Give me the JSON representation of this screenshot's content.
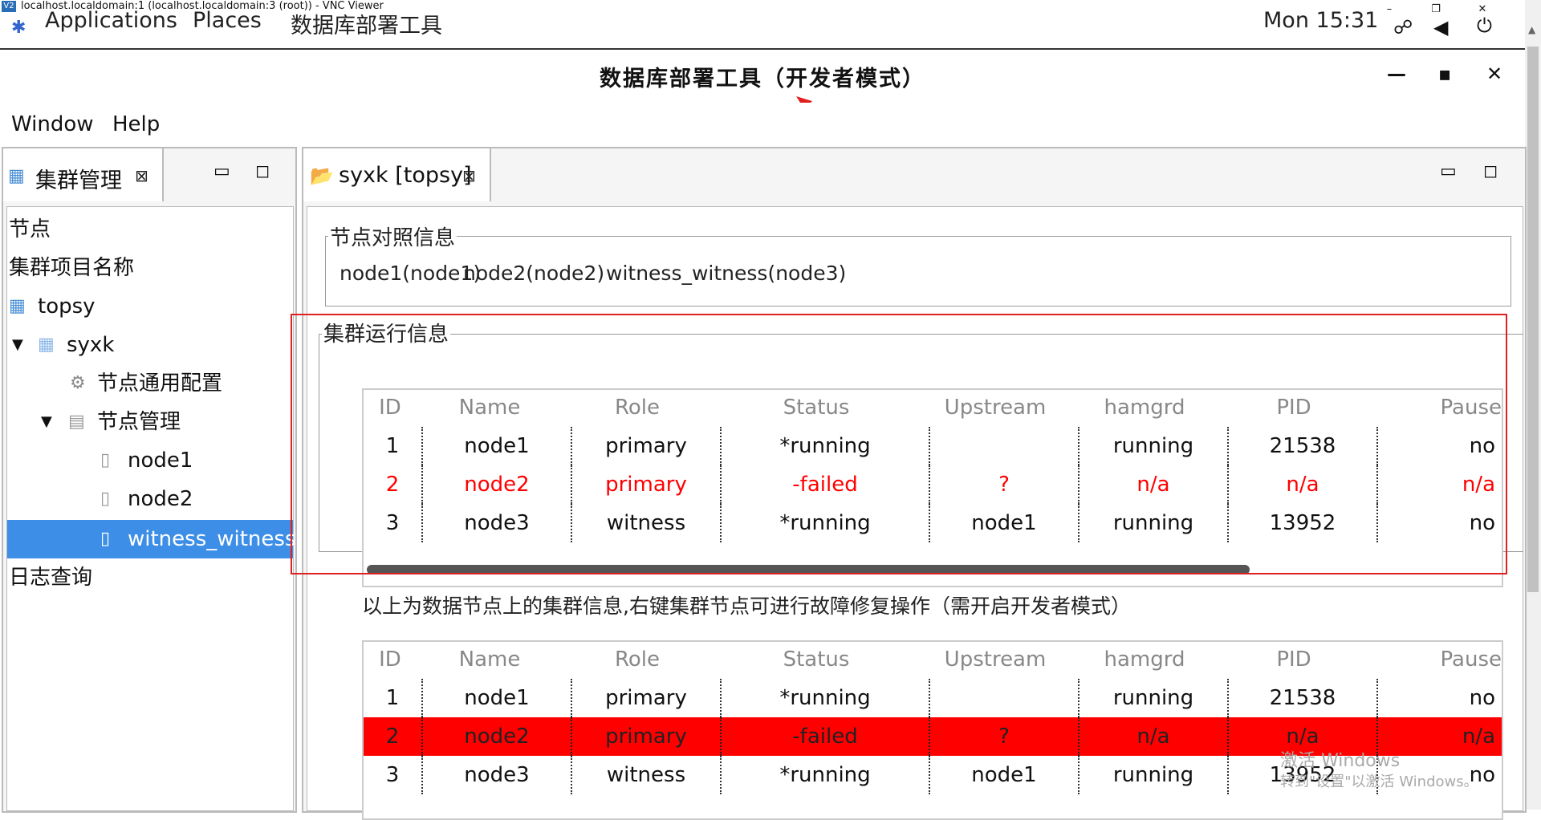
{
  "vnc": {
    "title": "localhost.localdomain:1 (localhost.localdomain:3 (root)) - VNC Viewer",
    "logo": "V2"
  },
  "topbar": {
    "applications": "Applications",
    "places": "Places",
    "app_name": "数据库部署工具",
    "clock": "Mon 15:31"
  },
  "window": {
    "title": "数据库部署工具（开发者模式）",
    "minimize": "—",
    "maximize": "▪",
    "close": "✕"
  },
  "menu": {
    "window": "Window",
    "help": "Help"
  },
  "left_view": {
    "tab_label": "集群管理",
    "tree": [
      {
        "label": "节点"
      },
      {
        "label": "集群项目名称"
      },
      {
        "label": "topsy"
      },
      {
        "label": "syxk"
      },
      {
        "label": "节点通用配置"
      },
      {
        "label": "节点管理"
      },
      {
        "label": "node1"
      },
      {
        "label": "node2"
      },
      {
        "label": "witness_witness"
      },
      {
        "label": "日志查询"
      }
    ]
  },
  "editor": {
    "tab_label": "syxk [topsy]",
    "node_map": {
      "title": "节点对照信息",
      "entries": [
        "node1(node1)",
        "node2(node2)",
        "witness_witness(node3)"
      ]
    },
    "cluster_info": {
      "title": "集群运行信息",
      "columns": [
        "ID",
        "Name",
        "Role",
        "Status",
        "Upstream",
        "hamgrd",
        "PID",
        "Pause"
      ],
      "rows": [
        [
          "1",
          "node1",
          "primary",
          "*running",
          "",
          "running",
          "21538",
          "no"
        ],
        [
          "2",
          "node2",
          "primary",
          "-failed",
          "?",
          "n/a",
          "n/a",
          "n/a"
        ],
        [
          "3",
          "node3",
          "witness",
          "*running",
          "node1",
          "running",
          "13952",
          "no"
        ]
      ]
    },
    "note": "以上为数据节点上的集群信息,右键集群节点可进行故障修复操作（需开启开发者模式）",
    "cluster_info_2": {
      "columns": [
        "ID",
        "Name",
        "Role",
        "Status",
        "Upstream",
        "hamgrd",
        "PID",
        "Pause"
      ],
      "rows": [
        [
          "1",
          "node1",
          "primary",
          "*running",
          "",
          "running",
          "21538",
          "no"
        ],
        [
          "2",
          "node2",
          "primary",
          "-failed",
          "?",
          "n/a",
          "n/a",
          "n/a"
        ],
        [
          "3",
          "node3",
          "witness",
          "*running",
          "node1",
          "running",
          "13952",
          "no"
        ]
      ]
    },
    "watermark_1": "激活 Windows",
    "watermark_2": "转到\"设置\"以激活 Windows。"
  },
  "colors": {
    "selection": "#3d8ee6",
    "error": "#ff0000",
    "highlight_box": "#e02020"
  }
}
